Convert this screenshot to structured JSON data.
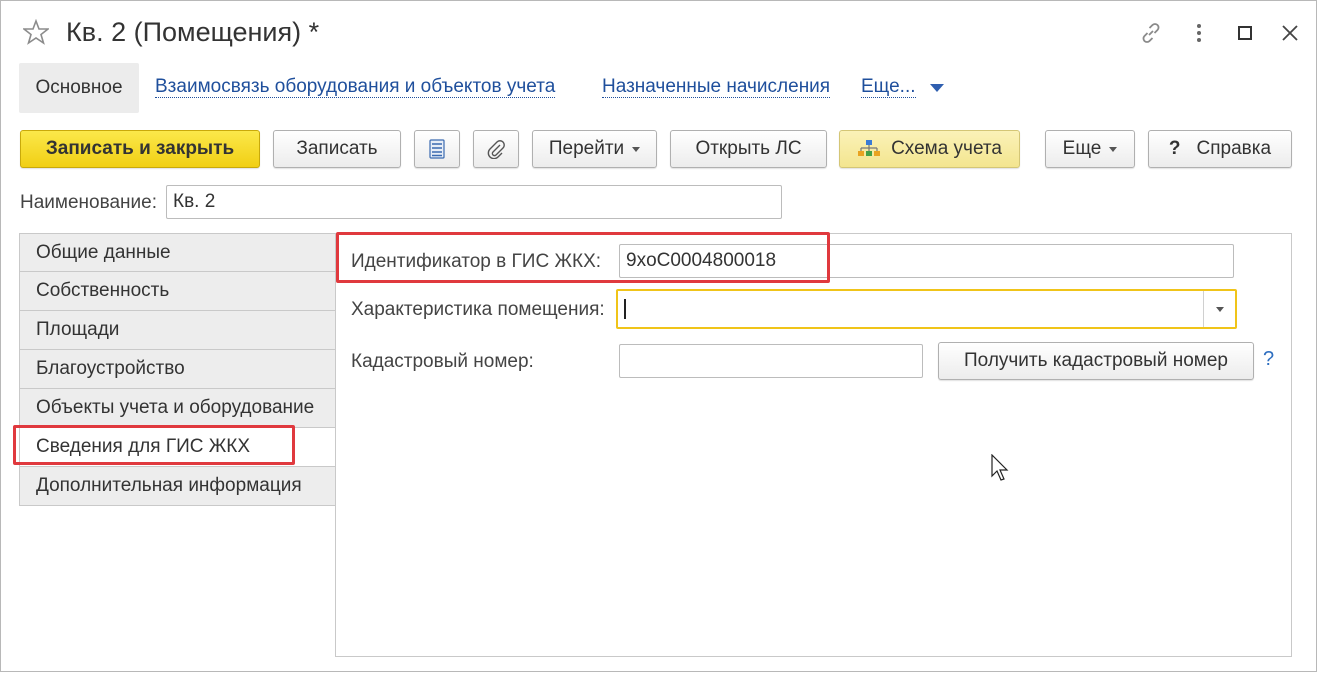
{
  "window": {
    "title": "Кв. 2 (Помещения) *"
  },
  "nav": {
    "active": "Основное",
    "links": [
      "Взаимосвязь оборудования и объектов учета",
      "Назначенные начисления",
      "Еще..."
    ]
  },
  "toolbar": {
    "save_close": "Записать и закрыть",
    "save": "Записать",
    "goto": "Перейти",
    "open_ls": "Открыть ЛС",
    "scheme": "Схема учета",
    "more": "Еще",
    "help": "Справка",
    "help_q": "?"
  },
  "name_field": {
    "label": "Наименование:",
    "value": "Кв. 2"
  },
  "tabs": [
    "Общие данные",
    "Собственность",
    "Площади",
    "Благоустройство",
    "Объекты учета и оборудование",
    "Сведения для ГИС ЖКХ",
    "Дополнительная информация"
  ],
  "active_tab_index": 5,
  "form": {
    "gis_id_label": "Идентификатор в ГИС ЖКХ:",
    "gis_id_value": "9xoC0004800018",
    "characteristic_label": "Характеристика помещения:",
    "characteristic_value": "",
    "cadastral_label": "Кадастровый номер:",
    "cadastral_value": "",
    "get_cadastral_button": "Получить кадастровый номер",
    "help_mark": "?"
  },
  "colors": {
    "primary_button": "#f1cf14",
    "link": "#1f4f9c",
    "highlight": "#e0393e",
    "focus_border": "#f0c419"
  }
}
